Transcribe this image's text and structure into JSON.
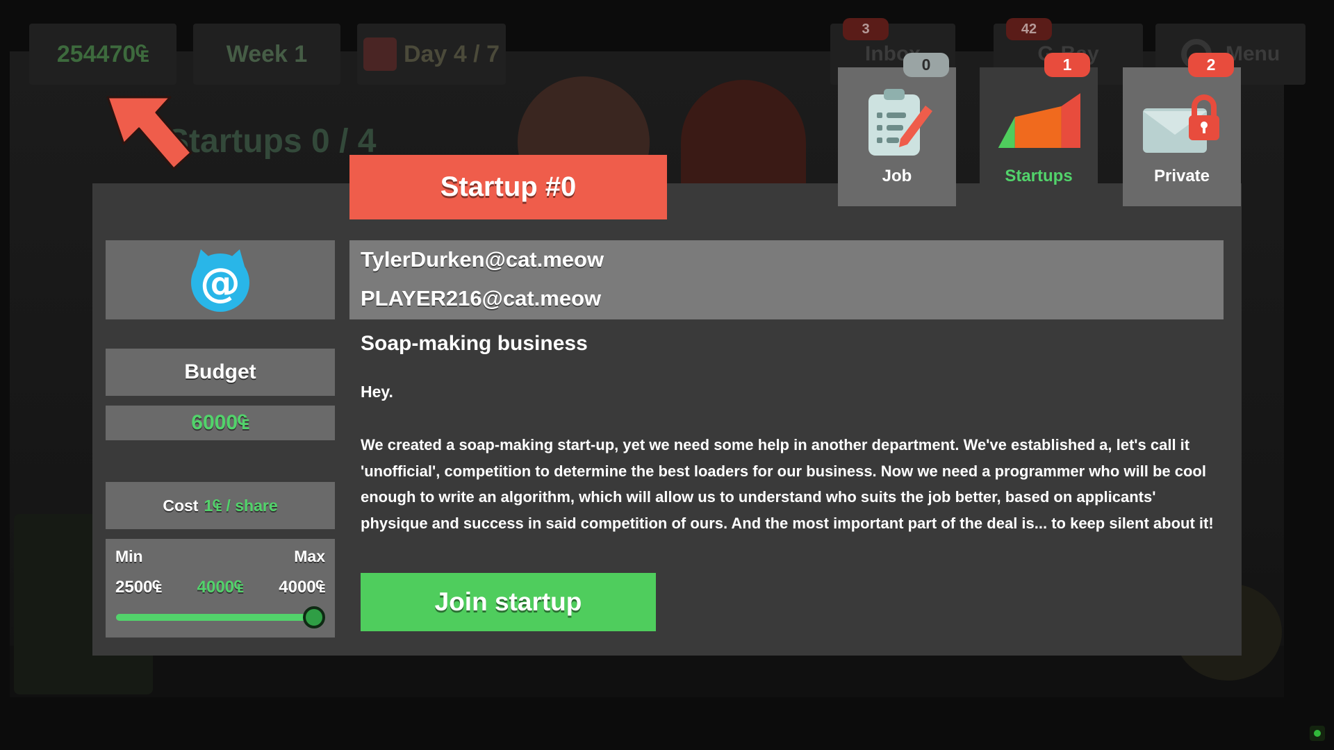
{
  "hud": {
    "money": "254470₠",
    "week": "Week 1",
    "day": "Day 4 / 7",
    "inbox_label": "Inbox",
    "inbox_badge": "3",
    "gbay_label": "G-Bay",
    "gbay_badge": "42",
    "menu_label": "Menu",
    "startups_count": "Startups 0 / 4"
  },
  "modal": {
    "title": "Startup #0",
    "tabs": [
      {
        "label": "Job",
        "badge": "0",
        "icon": "clipboard-pencil-icon",
        "active": false
      },
      {
        "label": "Startups",
        "badge": "1",
        "icon": "rising-chart-icon",
        "active": true
      },
      {
        "label": "Private",
        "badge": "2",
        "icon": "locked-envelope-icon",
        "active": false
      }
    ],
    "sender_icon": "cat-email-icon",
    "budget_label": "Budget",
    "budget_value": "6000₠",
    "cost_label": "Cost",
    "cost_value": "1₠ / share",
    "range": {
      "min_label": "Min",
      "max_label": "Max",
      "min_value": "2500₠",
      "current_value": "4000₠",
      "max_value": "4000₠",
      "slider_fraction": 1.0
    },
    "mail": {
      "from": "TylerDurken@cat.meow",
      "to": "PLAYER216@cat.meow",
      "subject": "Soap-making business",
      "greeting": "Hey.",
      "body": "We created a soap-making start-up, yet we need some help in another department. We've established a, let's call it 'unofficial', competition to determine the best loaders for our business. Now we need a programmer who will be cool enough to write an algorithm, which will allow us to understand who suits the job better, based on applicants' physique and success in said competition of ours. And the most important part of the deal is... to keep silent about it!"
    },
    "join_button": "Join startup"
  },
  "colors": {
    "accent_red": "#ef5d4b",
    "accent_green": "#52d36b",
    "panel": "#3a3a3a",
    "panel_light": "#6a6a6a",
    "button_green": "#4fcd5d"
  }
}
